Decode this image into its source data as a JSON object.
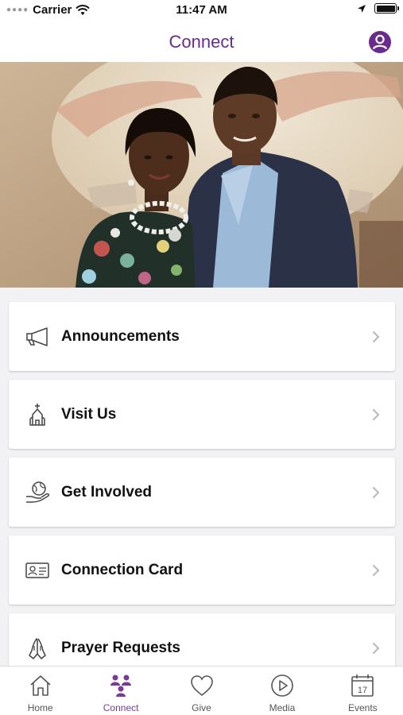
{
  "status_bar": {
    "carrier": "Carrier",
    "time": "11:47 AM"
  },
  "nav": {
    "title": "Connect"
  },
  "menu": {
    "items": [
      {
        "label": "Announcements",
        "icon": "megaphone-icon"
      },
      {
        "label": "Visit Us",
        "icon": "church-icon"
      },
      {
        "label": "Get Involved",
        "icon": "hand-globe-icon"
      },
      {
        "label": "Connection Card",
        "icon": "id-card-icon"
      },
      {
        "label": "Prayer Requests",
        "icon": "praying-hands-icon"
      }
    ]
  },
  "tabs": {
    "items": [
      {
        "label": "Home",
        "icon": "home-icon",
        "active": false
      },
      {
        "label": "Connect",
        "icon": "people-icon",
        "active": true
      },
      {
        "label": "Give",
        "icon": "heart-icon",
        "active": false
      },
      {
        "label": "Media",
        "icon": "play-icon",
        "active": false
      },
      {
        "label": "Events",
        "icon": "calendar-icon",
        "active": false
      }
    ],
    "calendar_day": "17"
  },
  "colors": {
    "accent": "#6a2c8c",
    "tab_active": "#7a3a9c",
    "background": "#f2f2f4"
  }
}
